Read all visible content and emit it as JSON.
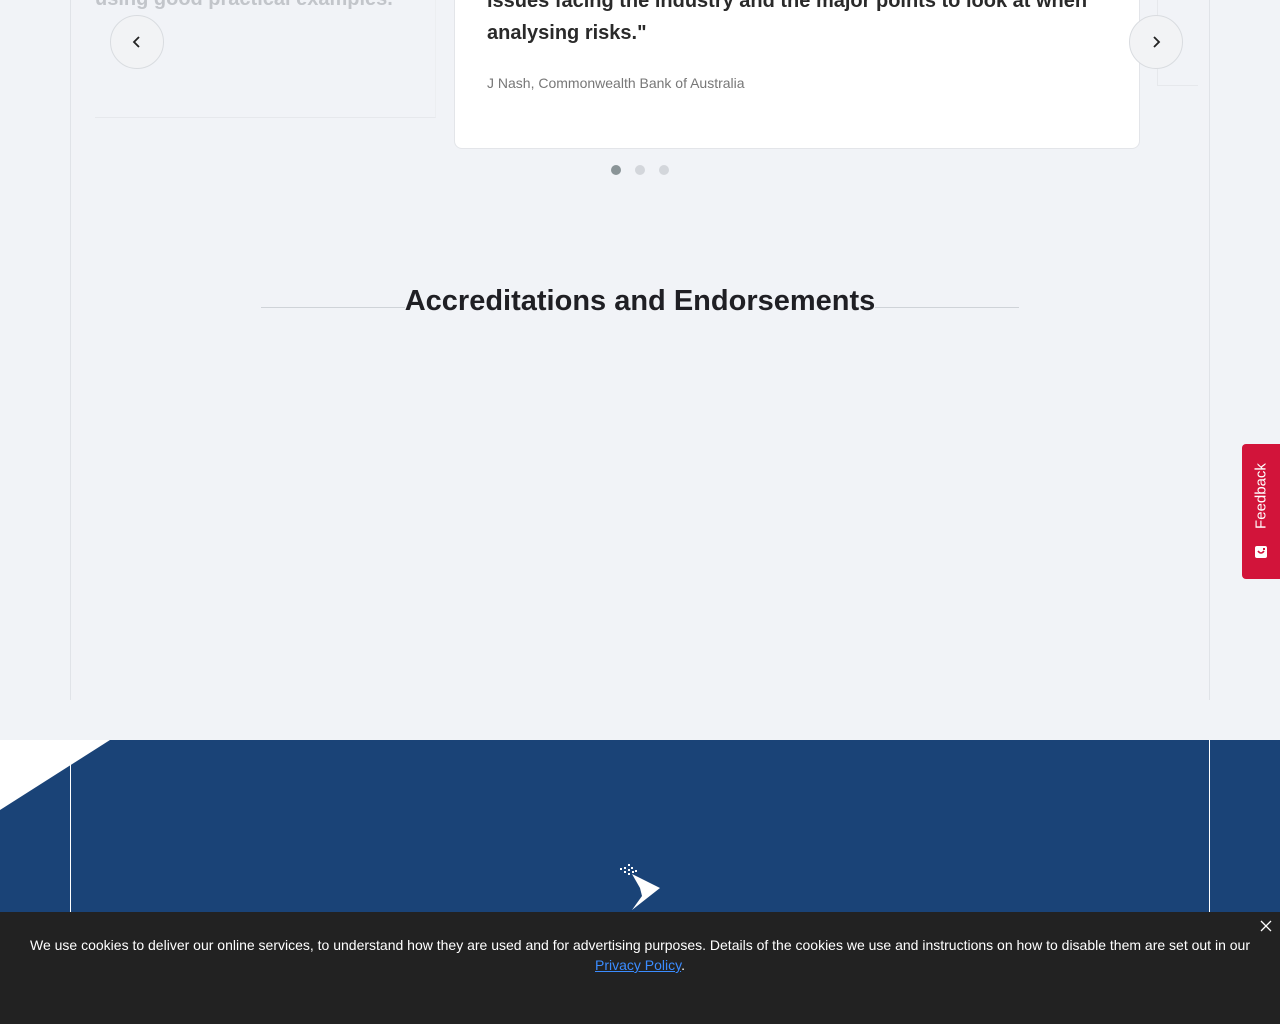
{
  "carousel": {
    "ghost_quote": "using good practical examples.\"",
    "quote_line1": "issues facing the industry and the major points to look at when",
    "quote_line2": "analysing risks.\"",
    "author": "J Nash, Commonwealth Bank of Australia",
    "prev_icon": "chevron-left-icon",
    "next_icon": "chevron-right-icon",
    "dots": {
      "count": 3,
      "active_index": 0
    }
  },
  "accreditations": {
    "title": "Accreditations and Endorsements"
  },
  "feedback": {
    "label": "Feedback",
    "icon": "feedback-icon",
    "color": "#d2143a"
  },
  "footer": {
    "background": "#1a4377",
    "logo_icon": "brand-logo-icon"
  },
  "cookie_banner": {
    "text": "We use cookies to deliver our online services, to understand how they are used and for advertising purposes. Details of the cookies we use and instructions on how to disable them are set out in our ",
    "link_label": "Privacy Policy",
    "suffix": ".",
    "close_icon": "close-icon"
  }
}
